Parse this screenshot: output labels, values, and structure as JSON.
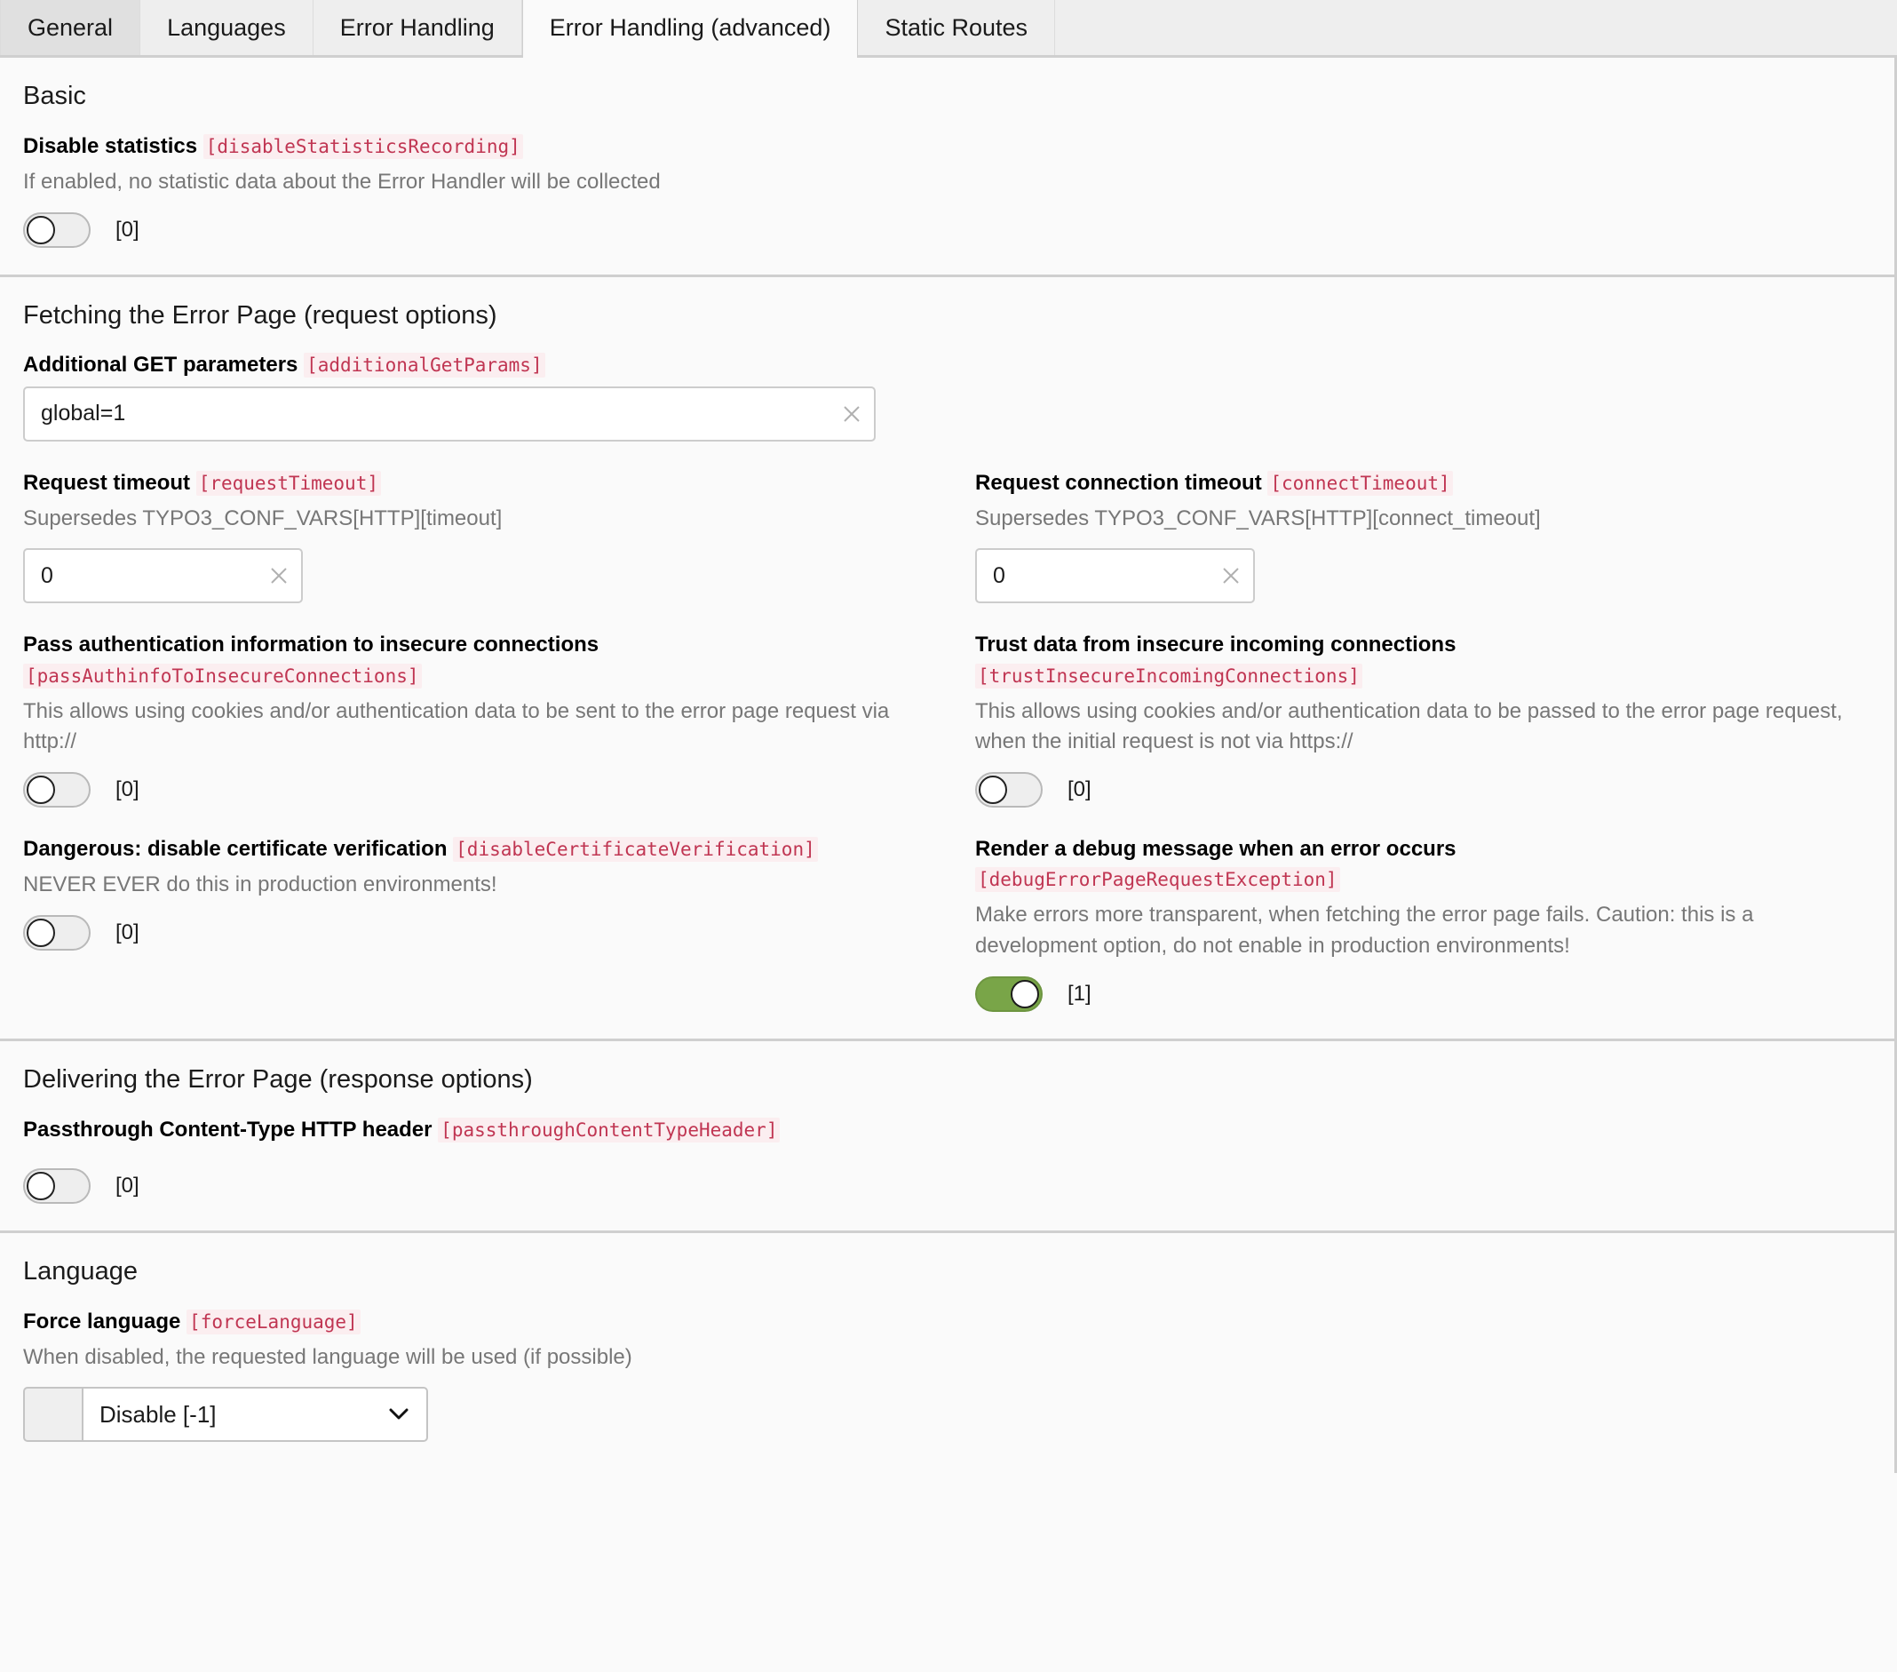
{
  "tabs": [
    {
      "label": "General",
      "state": "hover"
    },
    {
      "label": "Languages",
      "state": "normal"
    },
    {
      "label": "Error Handling",
      "state": "normal"
    },
    {
      "label": "Error Handling (advanced)",
      "state": "active"
    },
    {
      "label": "Static Routes",
      "state": "normal"
    }
  ],
  "colors": {
    "code_badge_text": "#c03552",
    "code_badge_bg": "#fbeef0",
    "toggle_on": "#79a548",
    "page_bg": "#fafafa",
    "tabbar_bg": "#eeeeee",
    "divider": "#cfcfcf"
  },
  "sections": {
    "basic": {
      "title": "Basic",
      "disable_statistics": {
        "label": "Disable statistics",
        "code": "[disableStatisticsRecording]",
        "description": "If enabled, no statistic data about the Error Handler will be collected",
        "toggle_state": "off",
        "value": "[0]"
      }
    },
    "fetching": {
      "title": "Fetching the Error Page (request options)",
      "additional_get_params": {
        "label": "Additional GET parameters",
        "code": "[additionalGetParams]",
        "value": "global=1",
        "placeholder": ""
      },
      "request_timeout": {
        "label": "Request timeout",
        "code": "[requestTimeout]",
        "description": "Supersedes TYPO3_CONF_VARS[HTTP][timeout]",
        "value": "0",
        "placeholder": ""
      },
      "connect_timeout": {
        "label": "Request connection timeout",
        "code": "[connectTimeout]",
        "description": "Supersedes TYPO3_CONF_VARS[HTTP][connect_timeout]",
        "value": "0",
        "placeholder": ""
      },
      "pass_authinfo": {
        "label": "Pass authentication information to insecure connections",
        "code": "[passAuthinfoToInsecureConnections]",
        "description": "This allows using cookies and/or authentication data to be sent to the error page request via http://",
        "toggle_state": "off",
        "value": "[0]"
      },
      "trust_insecure": {
        "label": "Trust data from insecure incoming connections",
        "code": "[trustInsecureIncomingConnections]",
        "description": "This allows using cookies and/or authentication data to be passed to the error page request, when the initial request is not via https://",
        "toggle_state": "off",
        "value": "[0]"
      },
      "disable_cert_verification": {
        "label": "Dangerous: disable certificate verification",
        "code": "[disableCertificateVerification]",
        "description": "NEVER EVER do this in production environments!",
        "toggle_state": "off",
        "value": "[0]"
      },
      "debug_error_page": {
        "label": "Render a debug message when an error occurs",
        "code": "[debugErrorPageRequestException]",
        "description": "Make errors more transparent, when fetching the error page fails. Caution: this is a development option, do not enable in production environments!",
        "toggle_state": "on",
        "value": "[1]"
      }
    },
    "delivering": {
      "title": "Delivering the Error Page (response options)",
      "passthrough_content_type": {
        "label": "Passthrough Content-Type HTTP header",
        "code": "[passthroughContentTypeHeader]",
        "toggle_state": "off",
        "value": "[0]"
      }
    },
    "language": {
      "title": "Language",
      "force_language": {
        "label": "Force language",
        "code": "[forceLanguage]",
        "description": "When disabled, the requested language will be used (if possible)",
        "selected": "Disable [-1]"
      }
    }
  },
  "icons": {
    "clear": "clear-icon",
    "chevron_down": "chevron-down-icon"
  }
}
